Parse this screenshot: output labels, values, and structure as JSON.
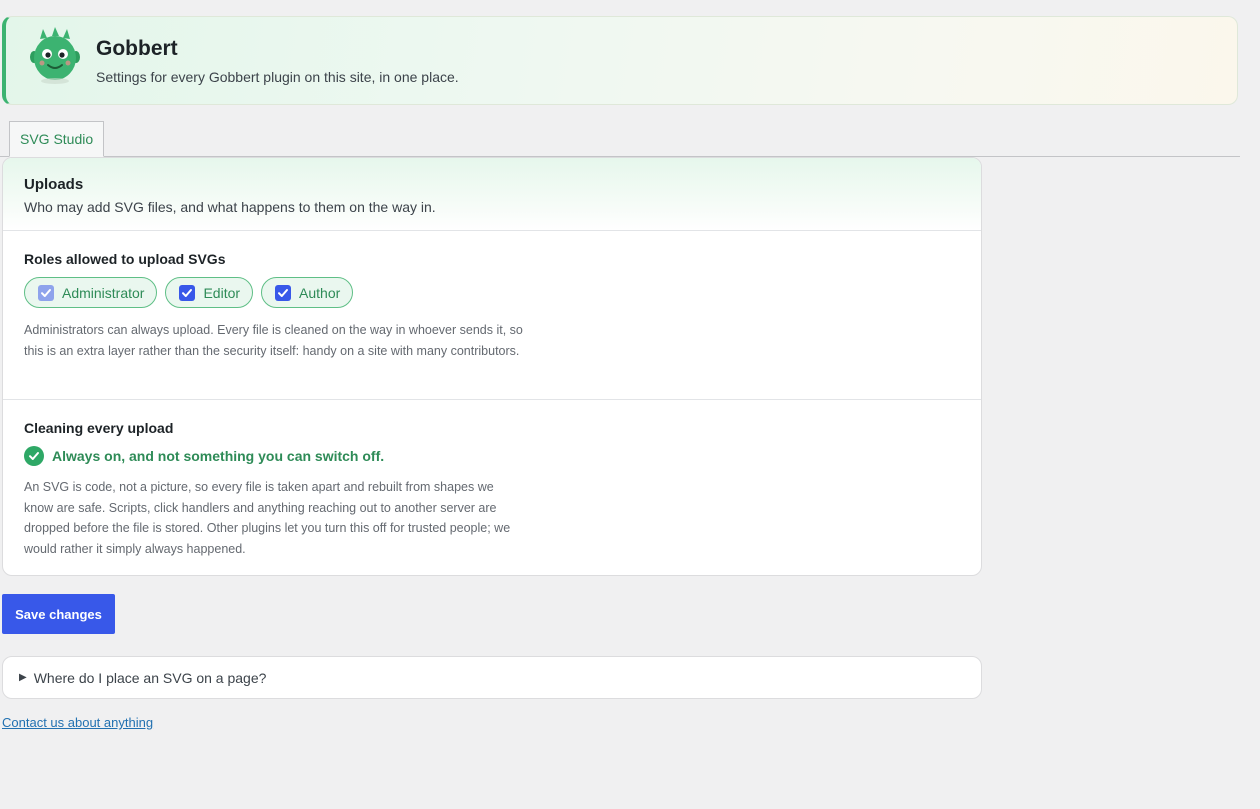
{
  "header": {
    "title": "Gobbert",
    "subtitle": "Settings for every Gobbert plugin on this site, in one place."
  },
  "tabs": [
    {
      "label": "SVG Studio",
      "active": true
    }
  ],
  "uploads": {
    "title": "Uploads",
    "description": "Who may add SVG files, and what happens to them on the way in.",
    "roles": {
      "label": "Roles allowed to upload SVGs",
      "options": [
        {
          "label": "Administrator",
          "checked": true,
          "disabled": true
        },
        {
          "label": "Editor",
          "checked": true,
          "disabled": false
        },
        {
          "label": "Author",
          "checked": true,
          "disabled": false
        }
      ],
      "note": "Administrators can always upload. Every file is cleaned on the way in whoever sends it, so this is an extra layer rather than the security itself: handy on a site with many contributors."
    },
    "cleaning": {
      "label": "Cleaning every upload",
      "status": "Always on, and not something you can switch off.",
      "note": "An SVG is code, not a picture, so every file is taken apart and rebuilt from shapes we know are safe. Scripts, click handlers and anything reaching out to another server are dropped before the file is stored. Other plugins let you turn this off for trusted people; we would rather it simply always happened."
    }
  },
  "actions": {
    "save_label": "Save changes"
  },
  "faq": {
    "question": "Where do I place an SVG on a page?"
  },
  "footer": {
    "contact_label": "Contact us about anything"
  },
  "colors": {
    "accent_green": "#2e8b57",
    "primary_blue": "#3858e9",
    "link_blue": "#2271b1"
  },
  "icons": {
    "mascot": "green-monster-mascot-icon",
    "checkbox": "checkmark-icon",
    "status": "check-circle-icon",
    "disclosure": "triangle-right-icon"
  }
}
